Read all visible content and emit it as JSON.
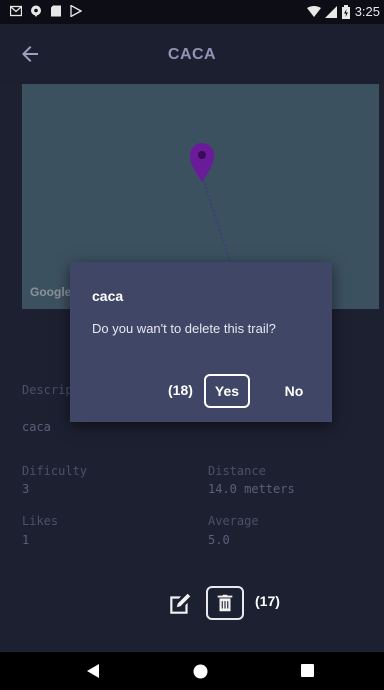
{
  "status_bar": {
    "time": "3:25",
    "icons": [
      "gmail-icon",
      "shield-icon",
      "sd-card-icon",
      "play-store-icon",
      "wifi-icon",
      "signal-icon",
      "battery-icon"
    ]
  },
  "app_bar": {
    "title": "CACA",
    "back_icon": "arrow-left-icon"
  },
  "map": {
    "attribution": "Google",
    "marker_color": "#6a1b9a",
    "background": "#3c5160"
  },
  "details": {
    "description_label": "Description",
    "description_value": "caca",
    "difficulty_label": "Dificulty",
    "difficulty_value": "3",
    "distance_label": "Distance",
    "distance_value": "14.0 metters",
    "likes_label": "Likes",
    "likes_value": "1",
    "average_label": "Average",
    "average_value": "5.0"
  },
  "actions": {
    "edit_icon": "edit-icon",
    "delete_icon": "trash-icon",
    "delete_annotation": "(17)"
  },
  "dialog": {
    "title": "caca",
    "message": "Do you wan't to delete this trail?",
    "yes_label": "Yes",
    "no_label": "No",
    "yes_annotation": "(18)",
    "background": "#404766"
  },
  "nav_bar": {
    "icons": [
      "back-triangle-icon",
      "home-circle-icon",
      "recents-square-icon"
    ]
  }
}
